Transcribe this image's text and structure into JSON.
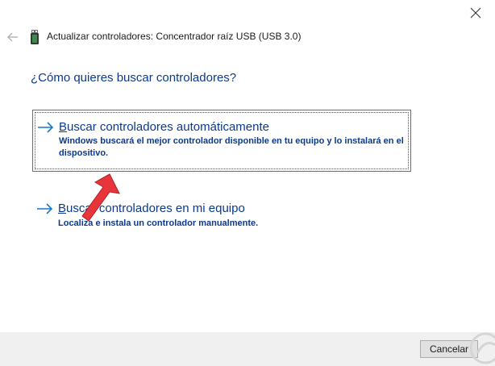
{
  "window": {
    "title": "Actualizar controladores: Concentrador raíz USB (USB 3.0)",
    "close_symbol": "×",
    "back_symbol": "←"
  },
  "question": "¿Cómo quieres buscar controladores?",
  "options": [
    {
      "title_first_letter": "B",
      "title_rest": "uscar controladores automáticamente",
      "description": "Windows buscará el mejor controlador disponible en tu equipo y lo instalará en el dispositivo."
    },
    {
      "title_first_letter": "B",
      "title_rest": "uscar controladores en mi equipo",
      "description": "Localiza e instala un controlador manualmente."
    }
  ],
  "footer": {
    "cancel_label": "Cancelar"
  },
  "colors": {
    "link_blue": "#0b3a8c",
    "arrow_blue": "#1979ca",
    "annotation_red": "#e8353b"
  },
  "icons": {
    "close": "close-icon",
    "back": "back-arrow-icon",
    "device": "usb-device-icon",
    "option_arrow": "right-arrow-icon",
    "annotation": "red-pointer-arrow-icon",
    "watermark": "brand-watermark-icon"
  }
}
